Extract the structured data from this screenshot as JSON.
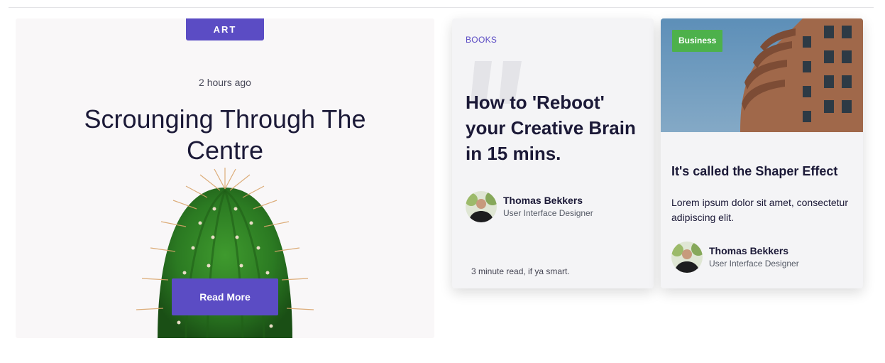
{
  "featured": {
    "category": "ART",
    "time": "2 hours ago",
    "title": "Scrounging Through The Centre",
    "button_label": "Read More"
  },
  "books_card": {
    "category": "BOOKS",
    "title": "How to 'Reboot' your Creative Brain in 15 mins.",
    "author": {
      "name": "Thomas Bekkers",
      "role": "User Interface Designer"
    },
    "read_time": "3 minute read, if ya smart."
  },
  "business_card": {
    "category": "Business",
    "title": "It's called the Shaper Effect",
    "excerpt": "Lorem ipsum dolor sit amet, consectetur adipiscing elit.",
    "author": {
      "name": "Thomas Bekkers",
      "role": "User Interface Designer"
    }
  },
  "colors": {
    "accent": "#5b4cc4",
    "business_badge": "#4db14b",
    "heading": "#1b1937"
  },
  "icons": {
    "quote": "quote-icon",
    "avatar": "avatar"
  }
}
